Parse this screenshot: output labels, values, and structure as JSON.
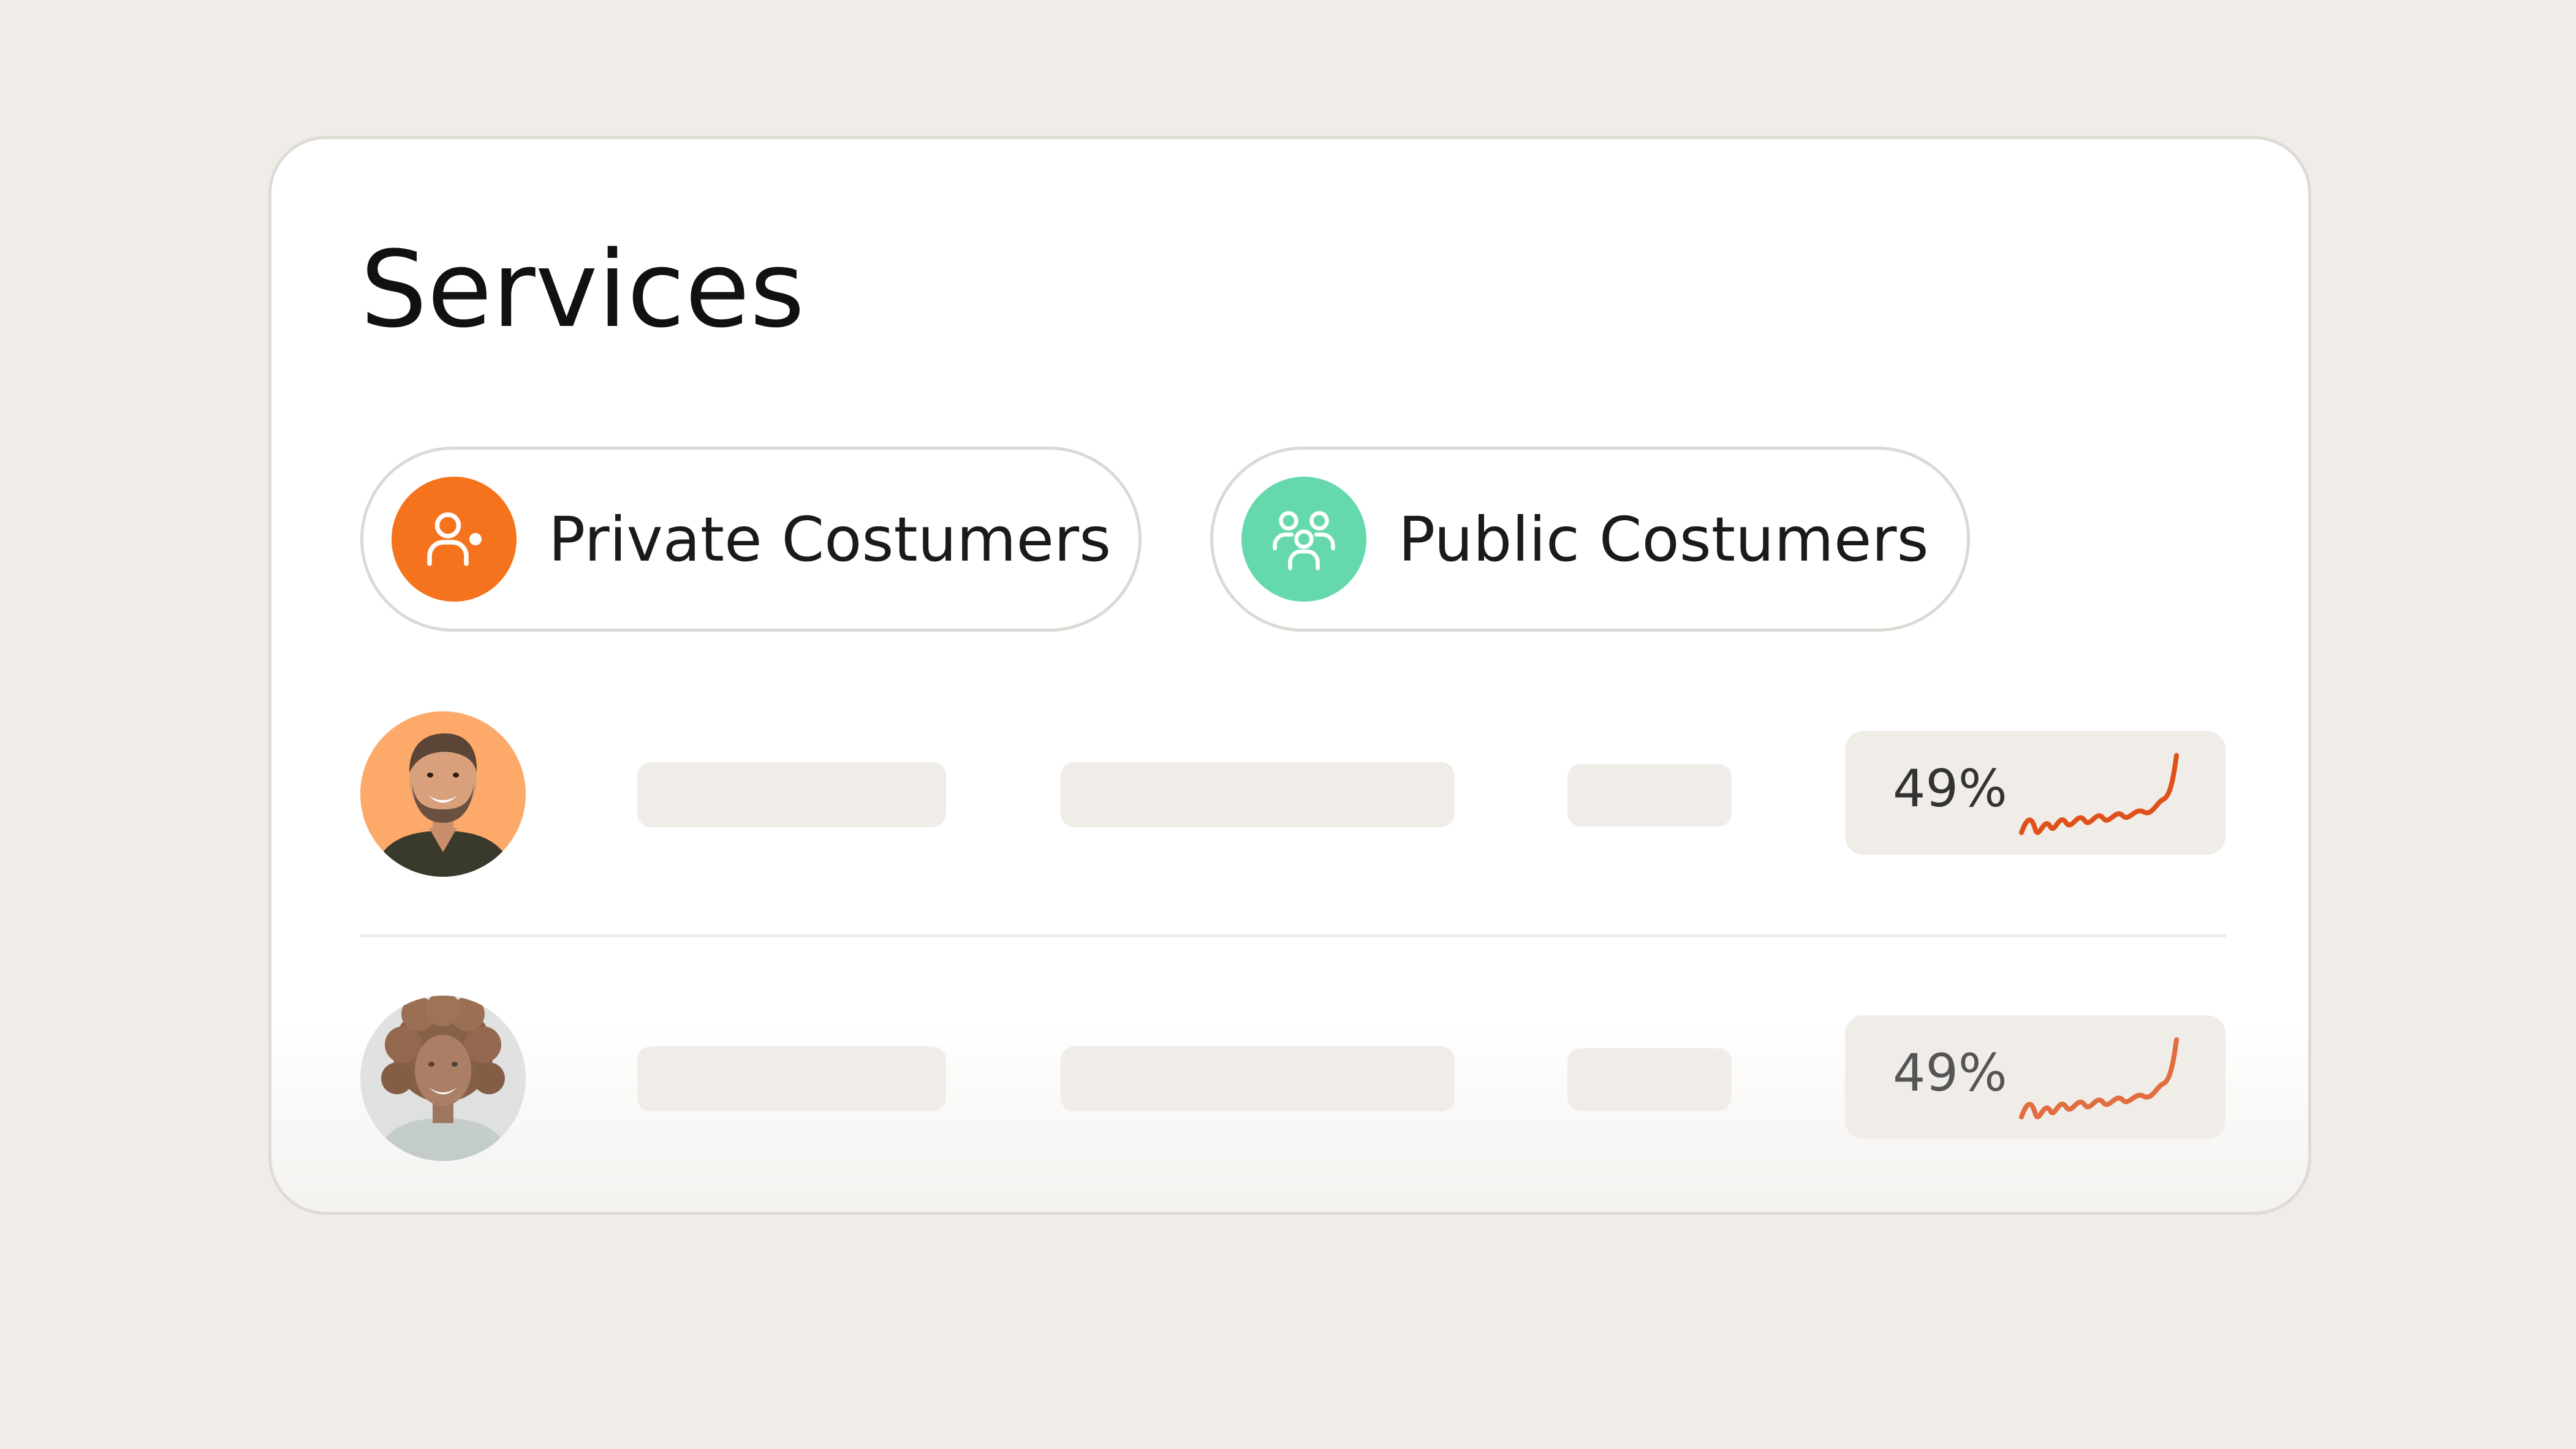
{
  "card": {
    "title": "Services"
  },
  "filters": [
    {
      "label": "Private Costumers",
      "icon": "person-icon",
      "color": "#f5731c"
    },
    {
      "label": "Public Costumers",
      "icon": "group-icon",
      "color": "#66d9ac"
    }
  ],
  "rows": [
    {
      "avatar": "man-avatar",
      "avatar_bg": "#fca96a",
      "stat": "49%",
      "trend_icon": "sparkline-icon",
      "trend_color": "#e0511a"
    },
    {
      "avatar": "woman-avatar",
      "avatar_bg": "#dadcdb",
      "stat": "49%",
      "trend_icon": "sparkline-icon",
      "trend_color": "#e0511a"
    }
  ],
  "colors": {
    "background": "#f0ede8",
    "card": "#ffffff",
    "placeholder": "#f0ede9"
  }
}
